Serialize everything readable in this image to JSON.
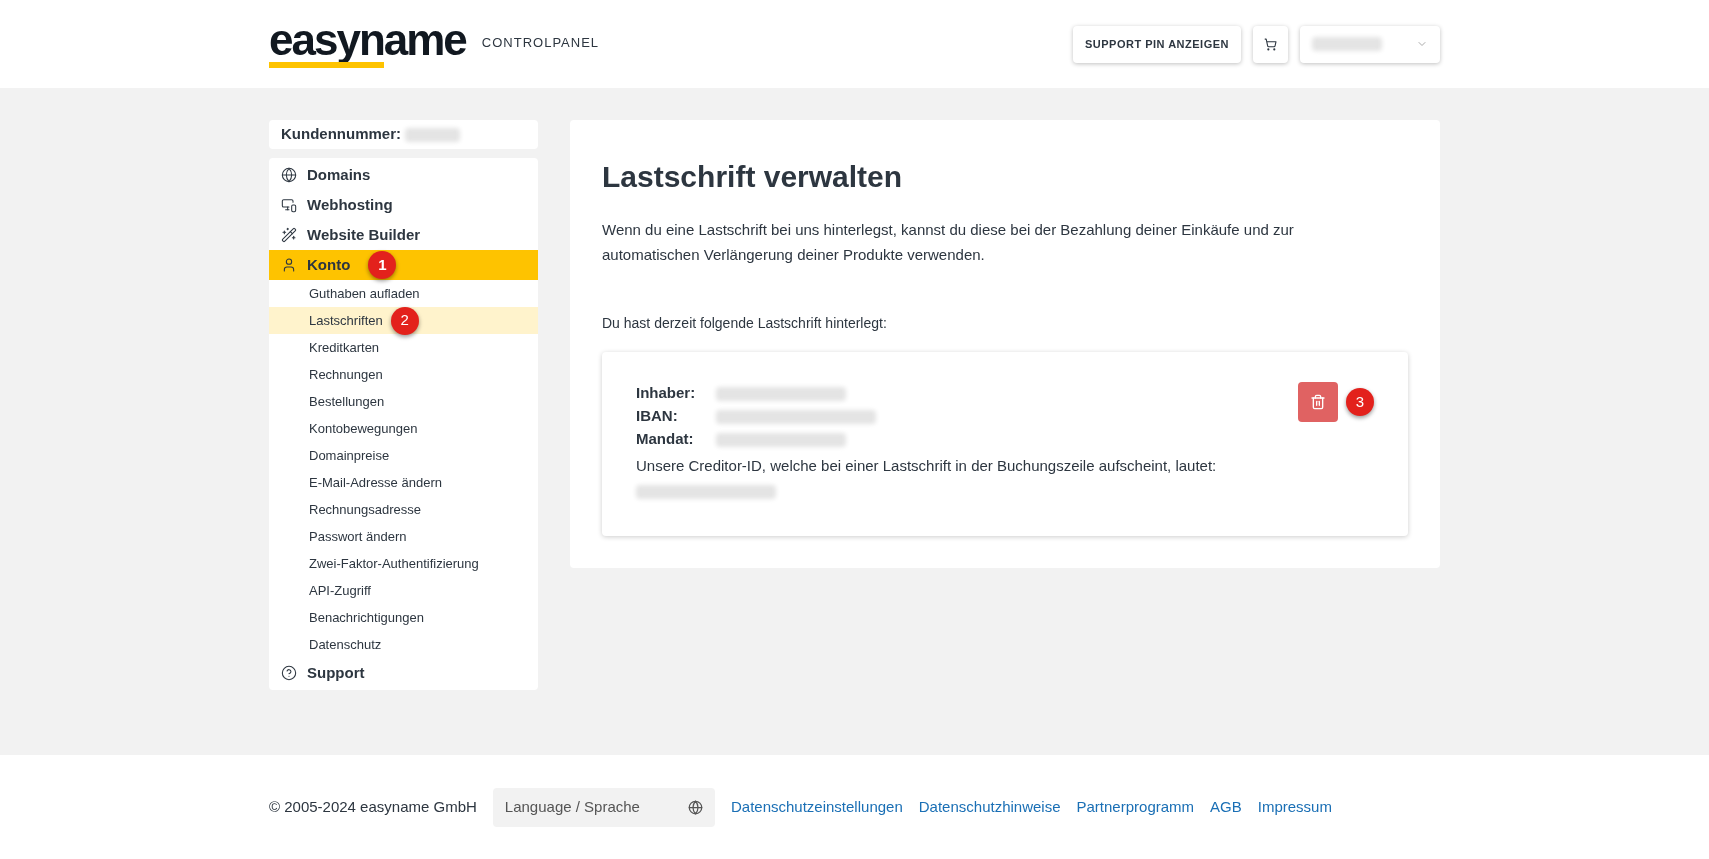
{
  "header": {
    "logo": "easyname",
    "subtitle": "CONTROLPANEL",
    "support_button": "SUPPORT PIN ANZEIGEN"
  },
  "sidebar": {
    "customer_label": "Kundennummer:",
    "nav": [
      {
        "label": "Domains",
        "selected": false
      },
      {
        "label": "Webhosting",
        "selected": false
      },
      {
        "label": "Website Builder",
        "selected": false
      },
      {
        "label": "Konto",
        "selected": true,
        "expanded": true,
        "badge": "1",
        "children": [
          {
            "label": "Guthaben aufladen",
            "selected": false
          },
          {
            "label": "Lastschriften",
            "selected": true,
            "badge": "2"
          },
          {
            "label": "Kreditkarten",
            "selected": false
          },
          {
            "label": "Rechnungen",
            "selected": false
          },
          {
            "label": "Bestellungen",
            "selected": false
          },
          {
            "label": "Kontobewegungen",
            "selected": false
          },
          {
            "label": "Domainpreise",
            "selected": false
          },
          {
            "label": "E-Mail-Adresse ändern",
            "selected": false
          },
          {
            "label": "Rechnungsadresse",
            "selected": false
          },
          {
            "label": "Passwort ändern",
            "selected": false
          },
          {
            "label": "Zwei-Faktor-Authentifizierung",
            "selected": false
          },
          {
            "label": "API-Zugriff",
            "selected": false
          },
          {
            "label": "Benachrichtigungen",
            "selected": false
          },
          {
            "label": "Datenschutz",
            "selected": false
          }
        ]
      },
      {
        "label": "Support",
        "selected": false
      }
    ]
  },
  "main": {
    "title": "Lastschrift verwalten",
    "intro": "Wenn du eine Lastschrift bei uns hinterlegst, kannst du diese bei der Bezahlung deiner Einkäufe und zur automatischen Verlängerung deiner Produkte verwenden.",
    "status": "Du hast derzeit folgende Lastschrift hinterlegt:",
    "mandate_card": {
      "fields": [
        {
          "label": "Inhaber:"
        },
        {
          "label": "IBAN:"
        },
        {
          "label": "Mandat:"
        }
      ],
      "creditor_note": "Unsere Creditor-ID, welche bei einer Lastschrift in der Buchungszeile aufscheint, lautet:",
      "delete_badge": "3"
    }
  },
  "footer": {
    "copyright": "© 2005-2024 easyname GmbH",
    "language_button": "Language / Sprache",
    "links": [
      "Datenschutzeinstellungen",
      "Datenschutzhinweise",
      "Partnerprogramm",
      "AGB",
      "Impressum"
    ]
  }
}
